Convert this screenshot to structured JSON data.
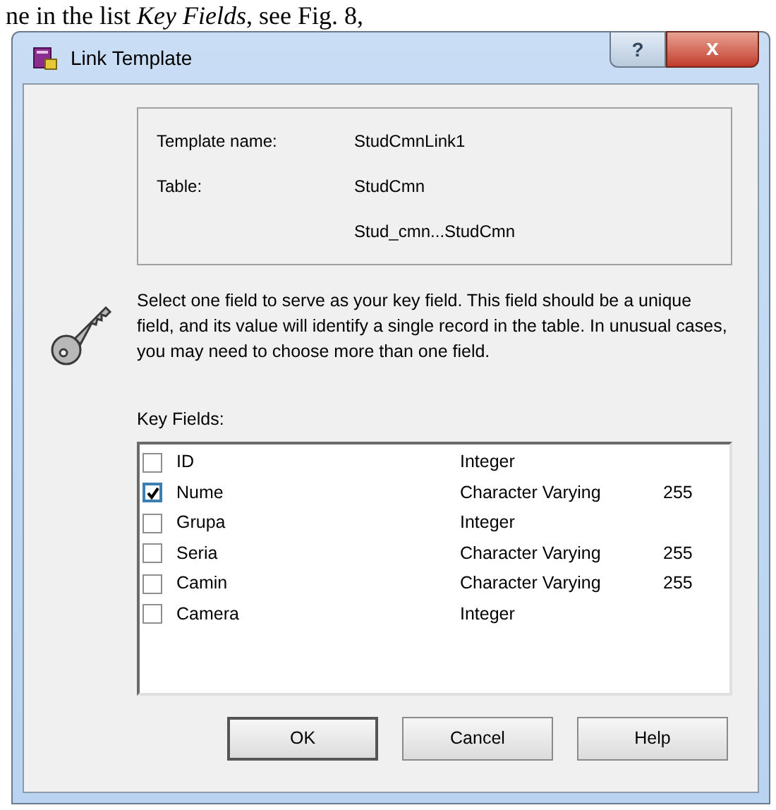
{
  "document_text": "ne in the list *Key Fields*, see Fig. 8,",
  "window": {
    "title": "Link Template",
    "help_button": "?",
    "close_button": "x"
  },
  "info": [
    {
      "label": "Template name:",
      "value": "StudCmnLink1"
    },
    {
      "label": "Table:",
      "value": "StudCmn"
    },
    {
      "value": "Stud_cmn...StudCmn"
    }
  ],
  "description": "Select one field to serve as your key field. This field should be a unique field, and its value will identify a single record in the table. In unusual cases, you may need to choose more than one field.",
  "key_fields_label": "Key Fields:",
  "key_fields": [
    {
      "name": "ID",
      "type": "Integer",
      "checked": false
    },
    {
      "name": "Nume",
      "type": "Character Varying",
      "size": "255",
      "checked": true
    },
    {
      "name": "Grupa",
      "type": "Integer",
      "checked": false
    },
    {
      "name": "Seria",
      "type": "Character Varying",
      "size": "255",
      "checked": false
    },
    {
      "name": "Camin",
      "type": "Character Varying",
      "size": "255",
      "checked": false
    },
    {
      "name": "Camera",
      "type": "Integer",
      "checked": false
    }
  ],
  "buttons": [
    "OK",
    "Cancel",
    "Help"
  ]
}
